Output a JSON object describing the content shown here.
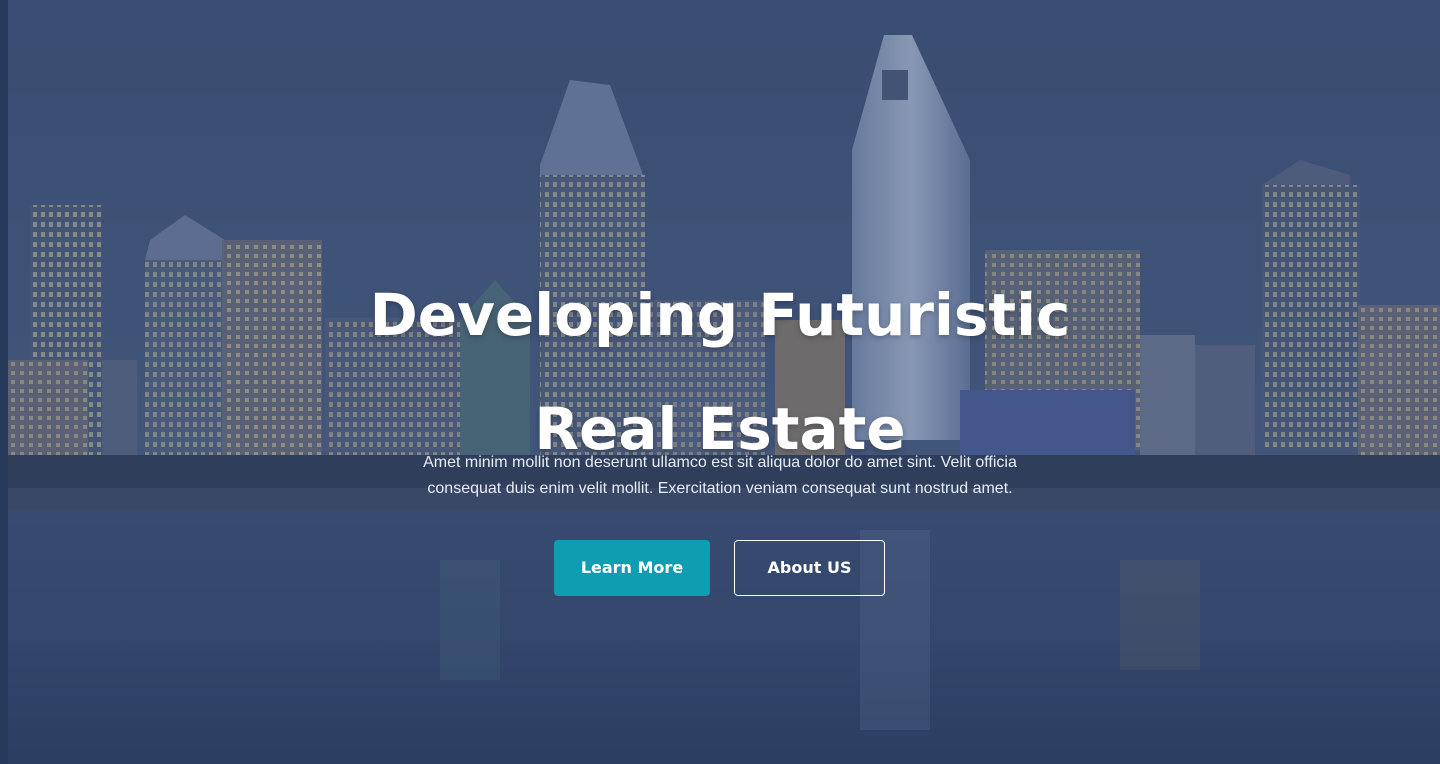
{
  "hero": {
    "headline_line1": "Developing Futuristic",
    "headline_line2": "Real Estate",
    "lead_line1": "Amet minim mollit non deserunt ullamco est sit aliqua dolor do amet sint. Velit officia",
    "lead_line2": "consequat duis enim velit mollit. Exercitation veniam consequat sunt nostrud amet.",
    "primary_button_label": "Learn More",
    "secondary_button_label": "About US"
  },
  "colors": {
    "overlay": "#3f5379",
    "accent": "#0f9db1",
    "text": "#ffffff"
  },
  "icons": {
    "background": "city-skyline-night-photo"
  }
}
